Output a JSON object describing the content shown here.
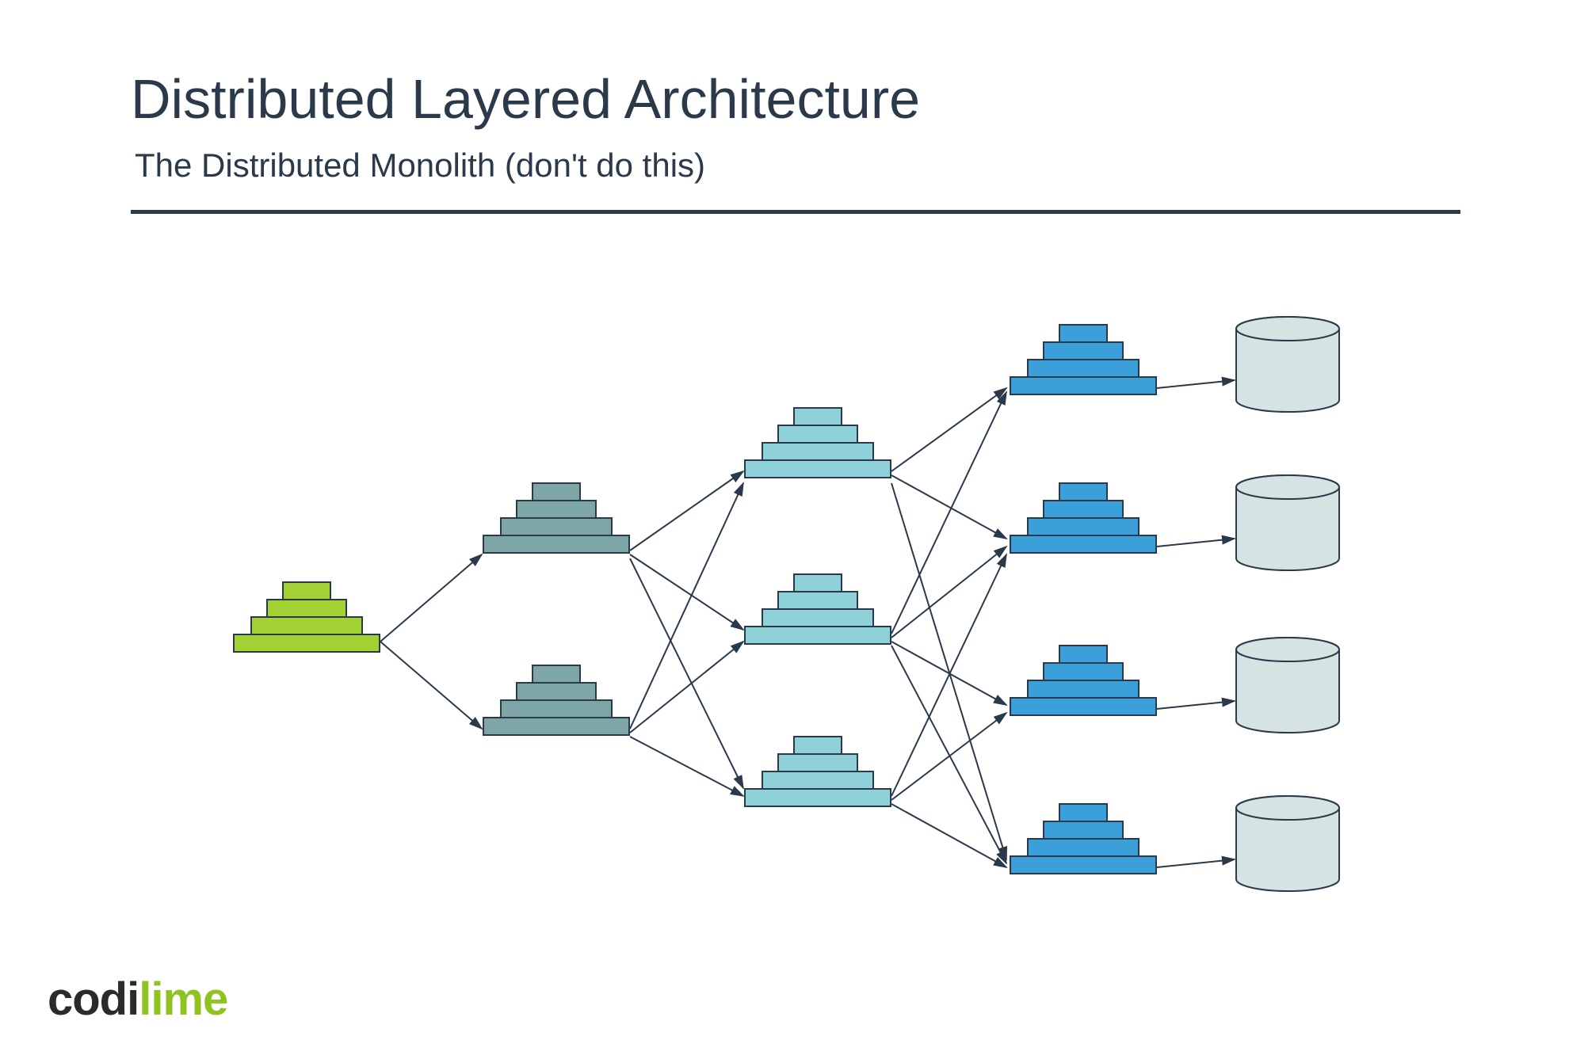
{
  "title": "Distributed Layered Architecture",
  "subtitle": "The Distributed Monolith (don't do this)",
  "logo": {
    "part1": "codi",
    "part2": "lime"
  },
  "colors": {
    "text": "#2b3a4a",
    "green_fill": "#a3d133",
    "green_stroke": "#2b3a4a",
    "teal_fill": "#7fa6a6",
    "teal_stroke": "#2b3a4a",
    "cyan_fill": "#8fd1d9",
    "cyan_stroke": "#2b3a4a",
    "blue_fill": "#3b9fd9",
    "blue_stroke": "#2b3a4a",
    "db_fill": "#d6e3e3",
    "db_stroke": "#2b3a4a",
    "arrow": "#2b3a4a"
  },
  "diagram": {
    "columns": [
      {
        "name": "col1",
        "color": "green",
        "count": 1
      },
      {
        "name": "col2",
        "color": "teal",
        "count": 2
      },
      {
        "name": "col3",
        "color": "cyan",
        "count": 3
      },
      {
        "name": "col4",
        "color": "blue",
        "count": 4
      },
      {
        "name": "db",
        "color": "db",
        "count": 4
      }
    ],
    "edges": [
      [
        "c1n1",
        "c2n1"
      ],
      [
        "c1n1",
        "c2n2"
      ],
      [
        "c2n1",
        "c3n1"
      ],
      [
        "c2n1",
        "c3n2"
      ],
      [
        "c2n1",
        "c3n3"
      ],
      [
        "c2n2",
        "c3n1"
      ],
      [
        "c2n2",
        "c3n2"
      ],
      [
        "c2n2",
        "c3n3"
      ],
      [
        "c3n1",
        "c4n1"
      ],
      [
        "c3n1",
        "c4n2"
      ],
      [
        "c3n1",
        "c4n4"
      ],
      [
        "c3n2",
        "c4n1"
      ],
      [
        "c3n2",
        "c4n2"
      ],
      [
        "c3n2",
        "c4n3"
      ],
      [
        "c3n2",
        "c4n4"
      ],
      [
        "c3n3",
        "c4n2"
      ],
      [
        "c3n3",
        "c4n3"
      ],
      [
        "c3n3",
        "c4n4"
      ],
      [
        "c4n1",
        "db1"
      ],
      [
        "c4n2",
        "db2"
      ],
      [
        "c4n3",
        "db3"
      ],
      [
        "c4n4",
        "db4"
      ]
    ]
  }
}
